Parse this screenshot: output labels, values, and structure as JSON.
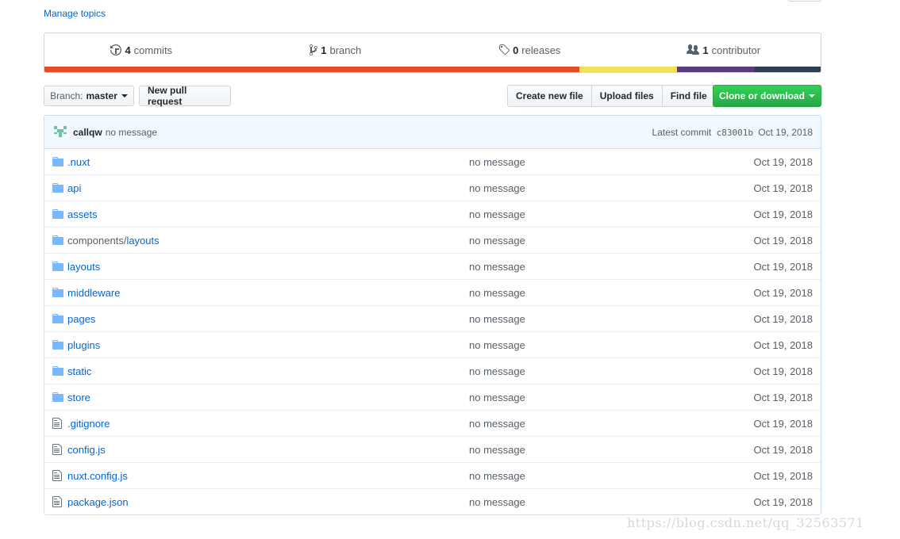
{
  "manage_topics": "Manage topics",
  "summary": {
    "commits": {
      "count": "4",
      "label": "commits"
    },
    "branches": {
      "count": "1",
      "label": "branch"
    },
    "releases": {
      "count": "0",
      "label": "releases"
    },
    "contributors": {
      "count": "1",
      "label": "contributor"
    },
    "language_bar": [
      {
        "color": "#e34c26",
        "fraction": 0.689
      },
      {
        "color": "#f1e05a",
        "fraction": 0.126
      },
      {
        "color": "#563d7c",
        "fraction": 0.1
      },
      {
        "color": "#2c3e50",
        "fraction": 0.085
      }
    ]
  },
  "toolbar": {
    "branch_prefix": "Branch:",
    "branch_name": "master",
    "new_pull_request": "New pull request",
    "create_new_file": "Create new file",
    "upload_files": "Upload files",
    "find_file": "Find file",
    "clone_or_download": "Clone or download"
  },
  "commit": {
    "author": "callqw",
    "message": "no message",
    "latest_label": "Latest commit",
    "sha": "c83001b",
    "date": "Oct 19, 2018"
  },
  "files": [
    {
      "type": "folder",
      "dir_prefix": "",
      "name": ".nuxt",
      "message": "no message",
      "age": "Oct 19, 2018"
    },
    {
      "type": "folder",
      "dir_prefix": "",
      "name": "api",
      "message": "no message",
      "age": "Oct 19, 2018"
    },
    {
      "type": "folder",
      "dir_prefix": "",
      "name": "assets",
      "message": "no message",
      "age": "Oct 19, 2018"
    },
    {
      "type": "folder",
      "dir_prefix": "components/",
      "name": "layouts",
      "message": "no message",
      "age": "Oct 19, 2018"
    },
    {
      "type": "folder",
      "dir_prefix": "",
      "name": "layouts",
      "message": "no message",
      "age": "Oct 19, 2018"
    },
    {
      "type": "folder",
      "dir_prefix": "",
      "name": "middleware",
      "message": "no message",
      "age": "Oct 19, 2018"
    },
    {
      "type": "folder",
      "dir_prefix": "",
      "name": "pages",
      "message": "no message",
      "age": "Oct 19, 2018"
    },
    {
      "type": "folder",
      "dir_prefix": "",
      "name": "plugins",
      "message": "no message",
      "age": "Oct 19, 2018"
    },
    {
      "type": "folder",
      "dir_prefix": "",
      "name": "static",
      "message": "no message",
      "age": "Oct 19, 2018"
    },
    {
      "type": "folder",
      "dir_prefix": "",
      "name": "store",
      "message": "no message",
      "age": "Oct 19, 2018"
    },
    {
      "type": "file",
      "dir_prefix": "",
      "name": ".gitignore",
      "message": "no message",
      "age": "Oct 19, 2018"
    },
    {
      "type": "file",
      "dir_prefix": "",
      "name": "config.js",
      "message": "no message",
      "age": "Oct 19, 2018"
    },
    {
      "type": "file",
      "dir_prefix": "",
      "name": "nuxt.config.js",
      "message": "no message",
      "age": "Oct 19, 2018"
    },
    {
      "type": "file",
      "dir_prefix": "",
      "name": "package.json",
      "message": "no message",
      "age": "Oct 19, 2018"
    }
  ],
  "watermark": "https://blog.csdn.net/qq_32563571"
}
